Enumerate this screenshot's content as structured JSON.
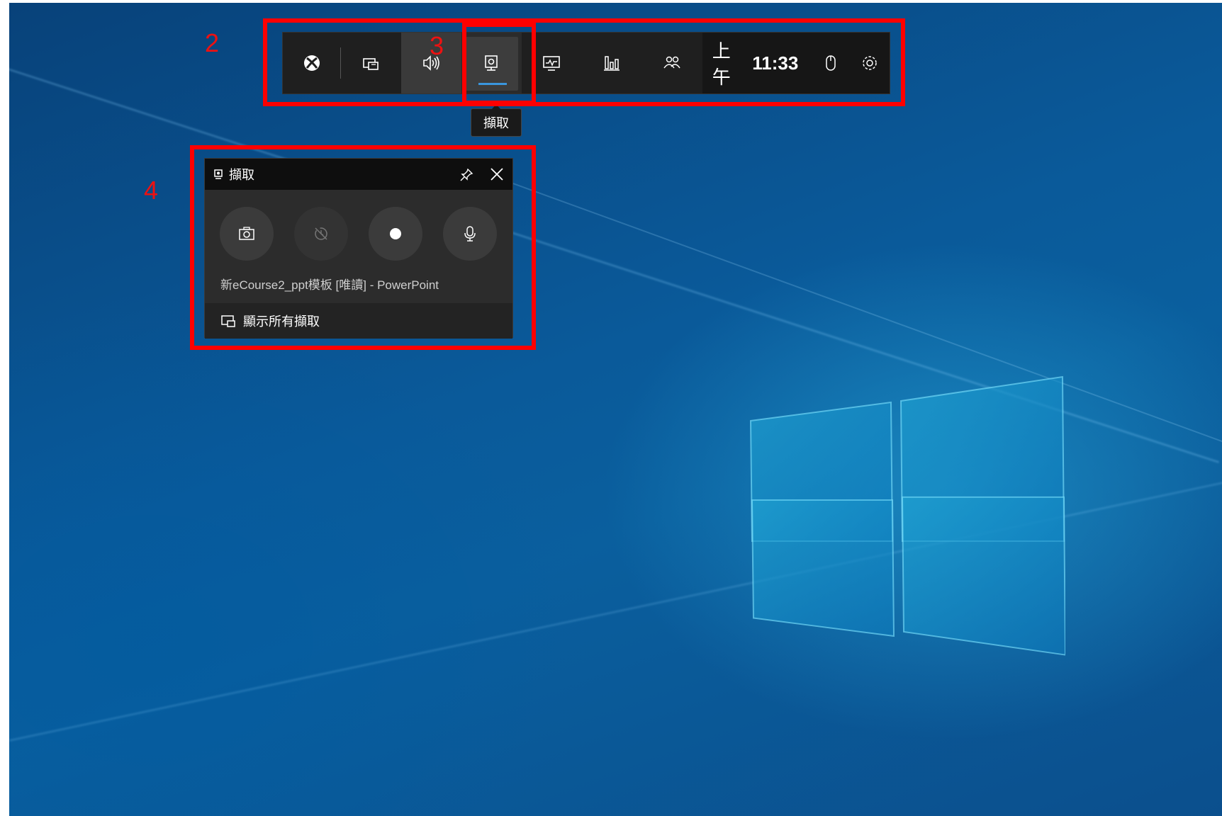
{
  "annotations": {
    "label_2": "2",
    "label_3": "3",
    "label_4": "4"
  },
  "gamebar": {
    "buttons": [
      {
        "name": "xbox-icon"
      },
      {
        "name": "widget-menu-icon"
      },
      {
        "name": "audio-icon"
      },
      {
        "name": "capture-icon"
      },
      {
        "name": "performance-icon"
      },
      {
        "name": "resources-icon"
      },
      {
        "name": "social-icon"
      }
    ],
    "time_prefix": "上午",
    "time": "11:33",
    "mouse_icon": "mouse-icon",
    "settings_icon": "gear-icon",
    "accent": "#3a96dd"
  },
  "tooltip": {
    "label": "擷取"
  },
  "capture_panel": {
    "title": "擷取",
    "source": "新eCourse2_ppt模板 [唯讀] - PowerPoint",
    "show_all": "顯示所有擷取",
    "controls": [
      "camera-icon",
      "record-last-disabled-icon",
      "record-dot-icon",
      "microphone-icon"
    ]
  }
}
